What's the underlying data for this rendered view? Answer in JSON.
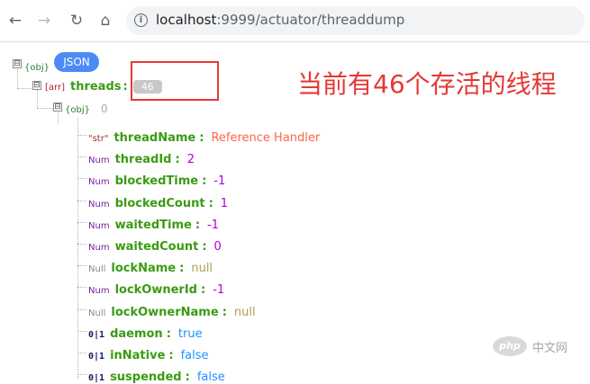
{
  "browser": {
    "back_icon": "arrow-left-icon",
    "forward_icon": "arrow-right-icon",
    "reload_icon": "reload-icon",
    "home_icon": "home-icon",
    "info_icon": "info-icon",
    "url_host": "localhost",
    "url_rest": ":9999/actuator/threaddump"
  },
  "viewer": {
    "json_button": "JSON",
    "root": {
      "toggle": "⊟",
      "tag": "{obj}"
    },
    "threads": {
      "toggle": "⊟",
      "tag": "[arr]",
      "key": "threads",
      "colon": ":",
      "count": "46"
    },
    "item": {
      "toggle": "⊟",
      "tag": "{obj}",
      "count": "0"
    },
    "fields": [
      {
        "tag": "\"str\"",
        "key": "threadName",
        "value": "Reference Handler"
      },
      {
        "tag": "Num",
        "key": "threadId",
        "value": "2"
      },
      {
        "tag": "Num",
        "key": "blockedTime",
        "value": "-1"
      },
      {
        "tag": "Num",
        "key": "blockedCount",
        "value": "1"
      },
      {
        "tag": "Num",
        "key": "waitedTime",
        "value": "-1"
      },
      {
        "tag": "Num",
        "key": "waitedCount",
        "value": "0"
      },
      {
        "tag": "Null",
        "key": "lockName",
        "value": "null"
      },
      {
        "tag": "Num",
        "key": "lockOwnerId",
        "value": "-1"
      },
      {
        "tag": "Null",
        "key": "lockOwnerName",
        "value": "null"
      },
      {
        "tag": "0|1",
        "key": "daemon",
        "value": "true"
      },
      {
        "tag": "0|1",
        "key": "inNative",
        "value": "false"
      },
      {
        "tag": "0|1",
        "key": "suspended",
        "value": "false"
      }
    ],
    "colon": ":"
  },
  "annotation": {
    "text": "当前有46个存活的线程"
  },
  "watermark": {
    "logo": "php",
    "text": "中文网"
  }
}
